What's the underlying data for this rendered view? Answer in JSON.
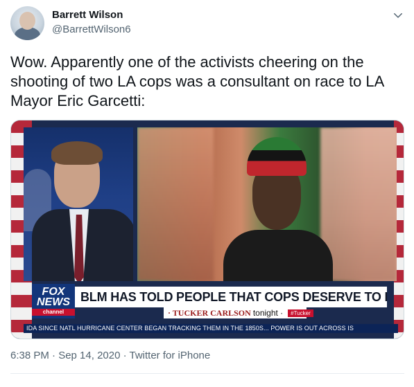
{
  "author": {
    "name": "Barrett Wilson",
    "handle": "@BarrettWilson6"
  },
  "tweet": {
    "text": "Wow. Apparently one of the activists cheering on the\nshooting of two LA cops was a consultant on race to LA\nMayor Eric Garcetti:"
  },
  "media": {
    "logo_line1": "FOX",
    "logo_line2": "NEWS",
    "logo_sub": "channel",
    "headline": "BLM HAS TOLD PEOPLE THAT COPS DESERVE TO DIE",
    "show_name": "· TUCKER CARLSON",
    "show_tonight": "tonight ·",
    "show_tag": "#Tucker",
    "ticker": "IDA SINCE NATL HURRICANE CENTER BEGAN TRACKING THEM IN THE 1850S...  POWER IS OUT ACROSS IS"
  },
  "meta": {
    "timestamp": "6:38 PM · Sep 14, 2020 · Twitter for iPhone"
  },
  "icons": {
    "caret": "chevron-down-icon"
  },
  "colors": {
    "secondary_text": "#536471",
    "fox_blue": "#12357a",
    "fox_red": "#c8102e"
  }
}
